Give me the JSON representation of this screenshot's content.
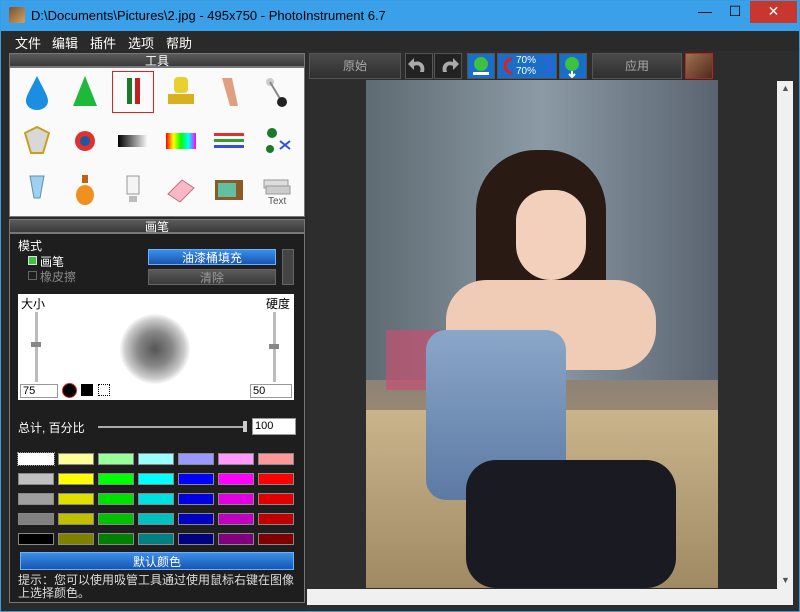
{
  "window": {
    "title": "D:\\Documents\\Pictures\\2.jpg - 495x750 - PhotoInstrument 6.7",
    "min_label": "—",
    "max_label": "☐",
    "close_label": "✕"
  },
  "menu": [
    "文件",
    "编辑",
    "插件",
    "选项",
    "帮助"
  ],
  "tools_panel": {
    "title": "工具"
  },
  "brush_panel": {
    "title": "画笔",
    "mode_label": "模式",
    "mode_brush": "画笔",
    "mode_eraser": "橡皮擦",
    "fill_button": "油漆桶填充",
    "clear_button": "清除",
    "size_label": "大小",
    "hardness_label": "硬度",
    "size_value": "75",
    "hardness_value": "50",
    "total_label": "总计, 百分比",
    "total_value": "100",
    "default_colors_button": "默认颜色",
    "hint": "提示：您可以使用吸管工具通过使用鼠标右键在图像上选择颜色。"
  },
  "toolbar": {
    "original_button": "原始",
    "apply_button": "应用",
    "zoom_top": "70%",
    "zoom_bottom": "70%"
  },
  "palette": [
    [
      "#ffffff",
      "#ffff99",
      "#99ff99",
      "#99ffff",
      "#9999ff",
      "#ff99ff",
      "#ff9999"
    ],
    [
      "#c0c0c0",
      "#ffff00",
      "#00ff00",
      "#00ffff",
      "#0000ff",
      "#ff00ff",
      "#ff0000"
    ],
    [
      "#a0a0a0",
      "#e0e000",
      "#00e000",
      "#00e0e0",
      "#0000e0",
      "#e000e0",
      "#e00000"
    ],
    [
      "#808080",
      "#c0c000",
      "#00c000",
      "#00c0c0",
      "#0000c0",
      "#c000c0",
      "#c00000"
    ],
    [
      "#000000",
      "#808000",
      "#008000",
      "#008080",
      "#000080",
      "#800080",
      "#800000"
    ]
  ]
}
